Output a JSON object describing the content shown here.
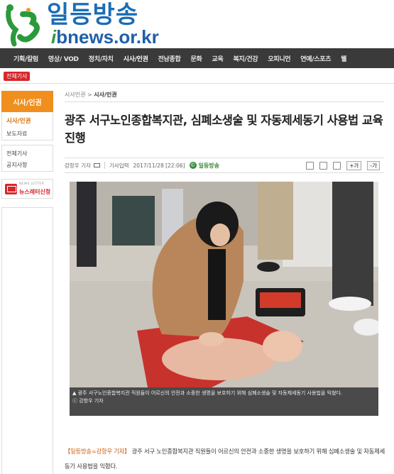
{
  "site": {
    "name": "일등방송",
    "url_prefix": "i",
    "url_rest": "bnews.or.kr"
  },
  "nav": {
    "items": [
      "기획/칼럼",
      "영상/ VOD",
      "정치/자치",
      "시사/인권",
      "전남종합",
      "문화",
      "교육",
      "복지/건강",
      "오피니언",
      "연예/스포츠",
      "웰"
    ],
    "active_index": 3
  },
  "all_articles_label": "전체기사",
  "sidebar": {
    "heading": "시사/인권",
    "items": [
      "시사/인권",
      "보도자료"
    ],
    "links": [
      "전체기사",
      "공지사항"
    ],
    "newsletter_caption": "NEWS LETTER",
    "newsletter_label": "뉴스레터신청"
  },
  "breadcrumb": {
    "parent": "시사인권",
    "separator": ">",
    "current": "시사/인권"
  },
  "article": {
    "title": "광주 서구노인종합복지관, 심폐소생술 및 자동제세동기 사용법 교육 진행",
    "reporter": "강항우 기자",
    "section": "기사입력",
    "datetime": "2017/11/28 [22:06]",
    "source": "일등방송",
    "font_up": "+가",
    "font_down": "-가",
    "caption": "▲ 광주 서구노인종합복지관 직원들이 어르신의 안전과 소중한 생명을 보호하기 위해 심폐소생술 및 자동제세동기 사용법을 익혔다.",
    "photo_credit": "ⓒ 강항우 기자",
    "lead": "【일등방송=강항우 기자】",
    "body_first": " 광주 서구 노인종합복지관 직원들이 어르신의 안전과 소중한 생명을 보호하기 위해 심폐소생술 및 자동제세동기 사용법을 익혔다."
  },
  "colors": {
    "brand_blue": "#1b6db5",
    "brand_green": "#2a9a3a",
    "nav_bg": "#3a3a3a",
    "accent_orange": "#f08e1e",
    "accent_red": "#d7262b"
  }
}
